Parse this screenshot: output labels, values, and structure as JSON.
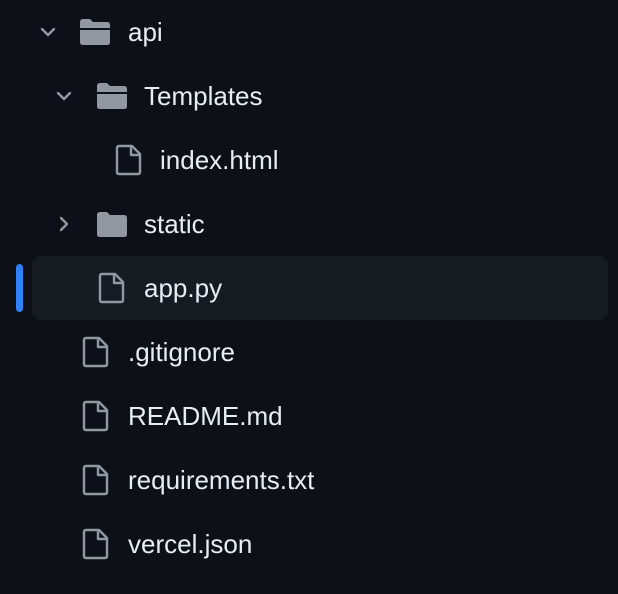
{
  "tree": {
    "items": [
      {
        "label": "api",
        "type": "folder",
        "expanded": true,
        "depth": 0
      },
      {
        "label": "Templates",
        "type": "folder",
        "expanded": true,
        "depth": 1
      },
      {
        "label": "index.html",
        "type": "file",
        "depth": 2
      },
      {
        "label": "static",
        "type": "folder",
        "expanded": false,
        "depth": 1
      },
      {
        "label": "app.py",
        "type": "file",
        "depth": 1,
        "selected": true
      },
      {
        "label": ".gitignore",
        "type": "file",
        "depth": 0
      },
      {
        "label": "README.md",
        "type": "file",
        "depth": 0
      },
      {
        "label": "requirements.txt",
        "type": "file",
        "depth": 0
      },
      {
        "label": "vercel.json",
        "type": "file",
        "depth": 0
      }
    ]
  },
  "colors": {
    "background": "#0d1117",
    "selected_background": "#161b22",
    "selection_indicator": "#2f81f7",
    "text": "#e6edf3",
    "icon": "#9198a1"
  }
}
